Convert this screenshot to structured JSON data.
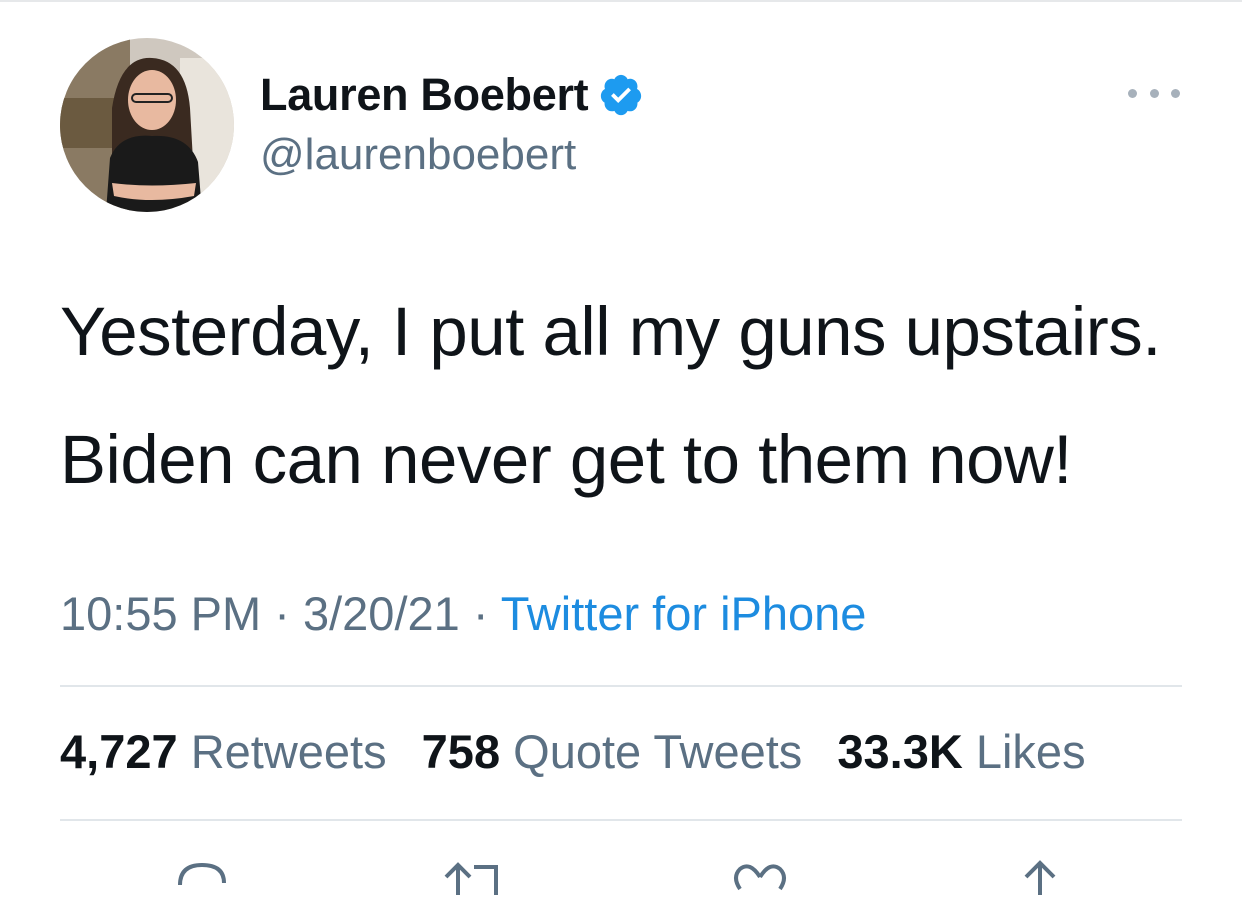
{
  "author": {
    "display_name": "Lauren Boebert",
    "handle": "@laurenboebert",
    "verified": true
  },
  "tweet": {
    "lines": [
      "Yesterday, I put all my guns upstairs.",
      "Biden can never get to them now!"
    ],
    "time": "10:55 PM",
    "date": "3/20/21",
    "source": "Twitter for iPhone",
    "separator": "·"
  },
  "stats": {
    "retweets": {
      "count": "4,727",
      "label": "Retweets"
    },
    "quotes": {
      "count": "758",
      "label": "Quote Tweets"
    },
    "likes": {
      "count": "33.3K",
      "label": "Likes"
    }
  },
  "icons": {
    "verified": "verified-badge-icon",
    "more": "more-icon",
    "reply": "reply-icon",
    "retweet": "retweet-icon",
    "like": "like-icon",
    "share": "share-icon"
  },
  "colors": {
    "accent": "#1d9bf0",
    "verified": "#1d9bf0",
    "secondary_text": "#5b7083"
  }
}
